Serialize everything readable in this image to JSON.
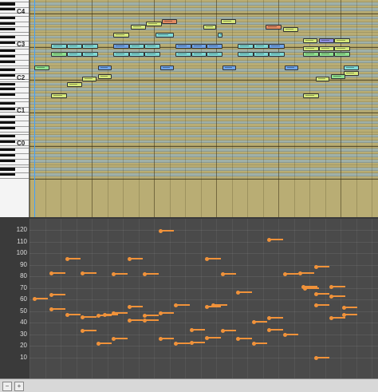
{
  "piano": {
    "octave_labels": [
      {
        "text": "C4",
        "pitch": 60
      },
      {
        "text": "C3",
        "pitch": 48
      },
      {
        "text": "C2",
        "pitch": 36
      },
      {
        "text": "C1",
        "pitch": 24
      },
      {
        "text": "C0",
        "pitch": 12
      }
    ]
  },
  "notes": [
    {
      "pitch": 57,
      "start": 8.5,
      "len": 1.0,
      "color": "#e38b62"
    },
    {
      "pitch": 57,
      "start": 12.3,
      "len": 1.0,
      "color": "#d6e87a"
    },
    {
      "pitch": 56,
      "start": 7.5,
      "len": 1.0,
      "color": "#d6e87a"
    },
    {
      "pitch": 55,
      "start": 6.5,
      "len": 1.0,
      "color": "#d6e87a"
    },
    {
      "pitch": 55,
      "start": 11.2,
      "len": 0.8,
      "color": "#d6e87a"
    },
    {
      "pitch": 55,
      "start": 15.2,
      "len": 1.0,
      "color": "#e38b62"
    },
    {
      "pitch": 54,
      "start": 16.3,
      "len": 1.0,
      "color": "#d6e87a"
    },
    {
      "pitch": 52,
      "start": 5.4,
      "len": 1.0,
      "color": "#d6e87a"
    },
    {
      "pitch": 52,
      "start": 8.1,
      "len": 1.2,
      "color": "#7fd9d6"
    },
    {
      "pitch": 52,
      "start": 12.1,
      "len": 0.3,
      "color": "#7fd9d6"
    },
    {
      "pitch": 50,
      "start": 17.6,
      "len": 0.9,
      "color": "#d6e87a"
    },
    {
      "pitch": 50,
      "start": 18.6,
      "len": 1.0,
      "color": "#8f8fe0"
    },
    {
      "pitch": 50,
      "start": 19.6,
      "len": 1.0,
      "color": "#d6e87a"
    },
    {
      "pitch": 48,
      "start": 1.4,
      "len": 1.0,
      "color": "#7fd9d6"
    },
    {
      "pitch": 48,
      "start": 2.4,
      "len": 1.0,
      "color": "#7fd9d6"
    },
    {
      "pitch": 48,
      "start": 3.4,
      "len": 1.0,
      "color": "#7fd9d6"
    },
    {
      "pitch": 48,
      "start": 5.4,
      "len": 1.0,
      "color": "#6fa4e8"
    },
    {
      "pitch": 48,
      "start": 6.4,
      "len": 1.0,
      "color": "#7fd9d6"
    },
    {
      "pitch": 48,
      "start": 7.4,
      "len": 1.0,
      "color": "#7fd9d6"
    },
    {
      "pitch": 48,
      "start": 9.4,
      "len": 1.0,
      "color": "#6fa4e8"
    },
    {
      "pitch": 48,
      "start": 10.4,
      "len": 1.0,
      "color": "#6fa4e8"
    },
    {
      "pitch": 48,
      "start": 11.4,
      "len": 1.0,
      "color": "#6fa4e8"
    },
    {
      "pitch": 48,
      "start": 13.4,
      "len": 1.0,
      "color": "#7fd9d6"
    },
    {
      "pitch": 48,
      "start": 14.4,
      "len": 1.0,
      "color": "#7fd9d6"
    },
    {
      "pitch": 48,
      "start": 15.4,
      "len": 1.0,
      "color": "#6fa4e8"
    },
    {
      "pitch": 47,
      "start": 17.6,
      "len": 1.0,
      "color": "#d6e87a"
    },
    {
      "pitch": 47,
      "start": 18.6,
      "len": 1.0,
      "color": "#d6e87a"
    },
    {
      "pitch": 47,
      "start": 19.6,
      "len": 1.0,
      "color": "#d6e87a"
    },
    {
      "pitch": 45,
      "start": 1.4,
      "len": 1.0,
      "color": "#8fe08f"
    },
    {
      "pitch": 45,
      "start": 2.4,
      "len": 1.0,
      "color": "#7fd9d6"
    },
    {
      "pitch": 45,
      "start": 3.4,
      "len": 1.0,
      "color": "#7fd9d6"
    },
    {
      "pitch": 45,
      "start": 5.4,
      "len": 1.0,
      "color": "#7fd9d6"
    },
    {
      "pitch": 45,
      "start": 6.4,
      "len": 1.0,
      "color": "#7fd9d6"
    },
    {
      "pitch": 45,
      "start": 7.4,
      "len": 1.0,
      "color": "#7fd9d6"
    },
    {
      "pitch": 45,
      "start": 9.4,
      "len": 1.0,
      "color": "#7fd9d6"
    },
    {
      "pitch": 45,
      "start": 10.4,
      "len": 1.0,
      "color": "#7fd9d6"
    },
    {
      "pitch": 45,
      "start": 11.4,
      "len": 1.0,
      "color": "#7fd9d6"
    },
    {
      "pitch": 45,
      "start": 13.4,
      "len": 1.0,
      "color": "#7fd9d6"
    },
    {
      "pitch": 45,
      "start": 14.4,
      "len": 1.0,
      "color": "#7fd9d6"
    },
    {
      "pitch": 45,
      "start": 15.4,
      "len": 1.0,
      "color": "#7fd9d6"
    },
    {
      "pitch": 45,
      "start": 17.6,
      "len": 1.0,
      "color": "#8fe08f"
    },
    {
      "pitch": 45,
      "start": 18.6,
      "len": 1.0,
      "color": "#8fe08f"
    },
    {
      "pitch": 45,
      "start": 19.6,
      "len": 1.0,
      "color": "#8fe08f"
    },
    {
      "pitch": 40,
      "start": 0.3,
      "len": 1.0,
      "color": "#8fe08f"
    },
    {
      "pitch": 40,
      "start": 4.4,
      "len": 0.9,
      "color": "#6fa4e8"
    },
    {
      "pitch": 40,
      "start": 8.4,
      "len": 0.9,
      "color": "#6fa4e8"
    },
    {
      "pitch": 40,
      "start": 12.4,
      "len": 0.9,
      "color": "#6fa4e8"
    },
    {
      "pitch": 40,
      "start": 16.4,
      "len": 0.9,
      "color": "#6fa4e8"
    },
    {
      "pitch": 40,
      "start": 20.2,
      "len": 1.0,
      "color": "#7fd9d6"
    },
    {
      "pitch": 38,
      "start": 20.2,
      "len": 1.0,
      "color": "#d6e87a"
    },
    {
      "pitch": 37,
      "start": 4.4,
      "len": 0.9,
      "color": "#d6e87a"
    },
    {
      "pitch": 37,
      "start": 19.4,
      "len": 0.9,
      "color": "#8fe08f"
    },
    {
      "pitch": 36,
      "start": 3.4,
      "len": 0.9,
      "color": "#d6e87a"
    },
    {
      "pitch": 36,
      "start": 18.4,
      "len": 0.9,
      "color": "#d6e87a"
    },
    {
      "pitch": 34,
      "start": 2.4,
      "len": 1.0,
      "color": "#d6e87a"
    },
    {
      "pitch": 30,
      "start": 1.4,
      "len": 1.0,
      "color": "#d6e87a"
    },
    {
      "pitch": 30,
      "start": 17.6,
      "len": 1.0,
      "color": "#d6e87a"
    }
  ],
  "velocity": {
    "ticks": [
      "120",
      "110",
      "100",
      "90",
      "80",
      "70",
      "60",
      "50",
      "40",
      "30",
      "20",
      "10"
    ],
    "bars": [
      {
        "v": 61,
        "start": 0.3
      },
      {
        "v": 64,
        "start": 1.4
      },
      {
        "v": 83,
        "start": 1.4
      },
      {
        "v": 52,
        "start": 1.4
      },
      {
        "v": 95,
        "start": 2.4
      },
      {
        "v": 47,
        "start": 2.4
      },
      {
        "v": 45,
        "start": 3.4
      },
      {
        "v": 83,
        "start": 3.4
      },
      {
        "v": 33,
        "start": 3.4
      },
      {
        "v": 46,
        "start": 4.4
      },
      {
        "v": 22,
        "start": 4.4
      },
      {
        "v": 47,
        "start": 4.8
      },
      {
        "v": 48,
        "start": 5.4
      },
      {
        "v": 82,
        "start": 5.4
      },
      {
        "v": 26,
        "start": 5.4
      },
      {
        "v": 95,
        "start": 6.4
      },
      {
        "v": 54,
        "start": 6.4
      },
      {
        "v": 42,
        "start": 6.4
      },
      {
        "v": 82,
        "start": 7.4
      },
      {
        "v": 46,
        "start": 7.4
      },
      {
        "v": 42,
        "start": 7.4
      },
      {
        "v": 119,
        "start": 8.4
      },
      {
        "v": 48,
        "start": 8.4
      },
      {
        "v": 26,
        "start": 8.4
      },
      {
        "v": 22,
        "start": 9.4
      },
      {
        "v": 55,
        "start": 9.4
      },
      {
        "v": 34,
        "start": 10.4
      },
      {
        "v": 23,
        "start": 10.4
      },
      {
        "v": 95,
        "start": 11.4
      },
      {
        "v": 54,
        "start": 11.4
      },
      {
        "v": 27,
        "start": 11.4
      },
      {
        "v": 55,
        "start": 11.8
      },
      {
        "v": 82,
        "start": 12.4
      },
      {
        "v": 33,
        "start": 12.4
      },
      {
        "v": 66,
        "start": 13.4
      },
      {
        "v": 26,
        "start": 13.4
      },
      {
        "v": 41,
        "start": 14.4
      },
      {
        "v": 22,
        "start": 14.4
      },
      {
        "v": 112,
        "start": 15.4
      },
      {
        "v": 44,
        "start": 15.4
      },
      {
        "v": 34,
        "start": 15.4
      },
      {
        "v": 82,
        "start": 16.4
      },
      {
        "v": 30,
        "start": 16.4
      },
      {
        "v": 83,
        "start": 17.4
      },
      {
        "v": 71,
        "start": 17.6
      },
      {
        "v": 70,
        "start": 17.7
      },
      {
        "v": 88,
        "start": 18.4
      },
      {
        "v": 55,
        "start": 18.4
      },
      {
        "v": 65,
        "start": 18.4
      },
      {
        "v": 10,
        "start": 18.4
      },
      {
        "v": 71,
        "start": 19.4
      },
      {
        "v": 44,
        "start": 19.4
      },
      {
        "v": 63,
        "start": 19.4
      },
      {
        "v": 53,
        "start": 20.2
      },
      {
        "v": 47,
        "start": 20.2
      }
    ]
  },
  "colors": {
    "grid_bg": "#b9ad74",
    "velocity_bar": "#f0923a"
  }
}
